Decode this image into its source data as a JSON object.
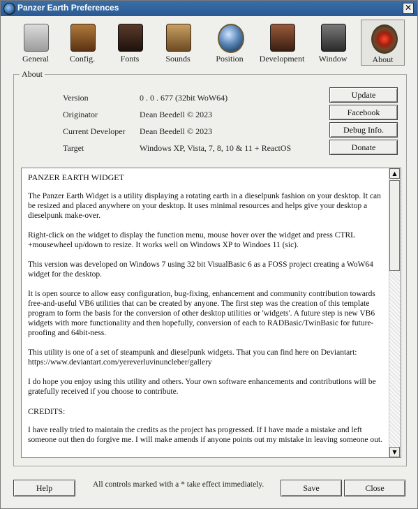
{
  "window": {
    "title": "Panzer Earth Preferences",
    "close_glyph": "✕"
  },
  "toolbar": {
    "items": [
      {
        "label": "General",
        "icon": "general-icon"
      },
      {
        "label": "Config.",
        "icon": "config-icon"
      },
      {
        "label": "Fonts",
        "icon": "fonts-icon"
      },
      {
        "label": "Sounds",
        "icon": "sounds-icon"
      },
      {
        "label": "Position",
        "icon": "position-icon"
      },
      {
        "label": "Development",
        "icon": "development-icon"
      },
      {
        "label": "Window",
        "icon": "window-icon"
      },
      {
        "label": "About",
        "icon": "about-icon",
        "selected": true
      }
    ]
  },
  "about": {
    "group_label": "About",
    "info": [
      {
        "key": "Version",
        "value": "0 . 0 . 677   (32bit WoW64)"
      },
      {
        "key": "Originator",
        "value": "Dean Beedell © 2023"
      },
      {
        "key": "Current Developer",
        "value": "Dean Beedell © 2023"
      },
      {
        "key": "Target",
        "value": "Windows XP, Vista, 7, 8, 10  & 11 + ReactOS"
      }
    ],
    "buttons": {
      "update": "Update",
      "facebook": "Facebook",
      "debug": "Debug Info.",
      "donate": "Donate"
    },
    "text": {
      "heading": "PANZER EARTH WIDGET",
      "p1": "The Panzer Earth Widget is a utility displaying a rotating earth in a dieselpunk fashion on your desktop. It can be resized and placed anywhere on your desktop. It uses minimal resources and helps give your desktop a dieselpunk make-over.",
      "p2": "Right-click on the widget to display the function menu, mouse hover over the widget and press CTRL +mousewheel up/down to resize. It works well on Windows XP to Windoes 11 (sic).",
      "p3": "This version was developed on Windows 7 using 32 bit VisualBasic 6 as a FOSS project creating a WoW64 widget for the desktop.",
      "p4": "It is open source to allow easy configuration, bug-fixing, enhancement and community contribution towards free-and-useful VB6 utilities that can be created by anyone. The first step was the creation of this template program to form the basis for the conversion of other desktop utilities or 'widgets'. A future step is new VB6 widgets with more functionality and then hopefully, conversion of each to RADBasic/TwinBasic for future-proofing and 64bit-ness.",
      "p5": "This utility is one of a set of steampunk and dieselpunk widgets. That you can find here on Deviantart: https://www.deviantart.com/yereverluvinuncleber/gallery",
      "p6": "I do hope you enjoy using this utility and others. Your own software enhancements and contributions will be gratefully received if you choose to contribute.",
      "credits": "CREDITS:",
      "p7": "I have really tried to maintain the credits as the project has progressed. If I have made a mistake and left someone out then do forgive me. I will make amends if anyone points out my mistake in leaving someone out."
    },
    "scroll": {
      "up": "▲",
      "down": "▼"
    }
  },
  "footer": {
    "help": "Help",
    "note": "All controls marked with a * take effect immediately.",
    "save": "Save",
    "close": "Close"
  }
}
